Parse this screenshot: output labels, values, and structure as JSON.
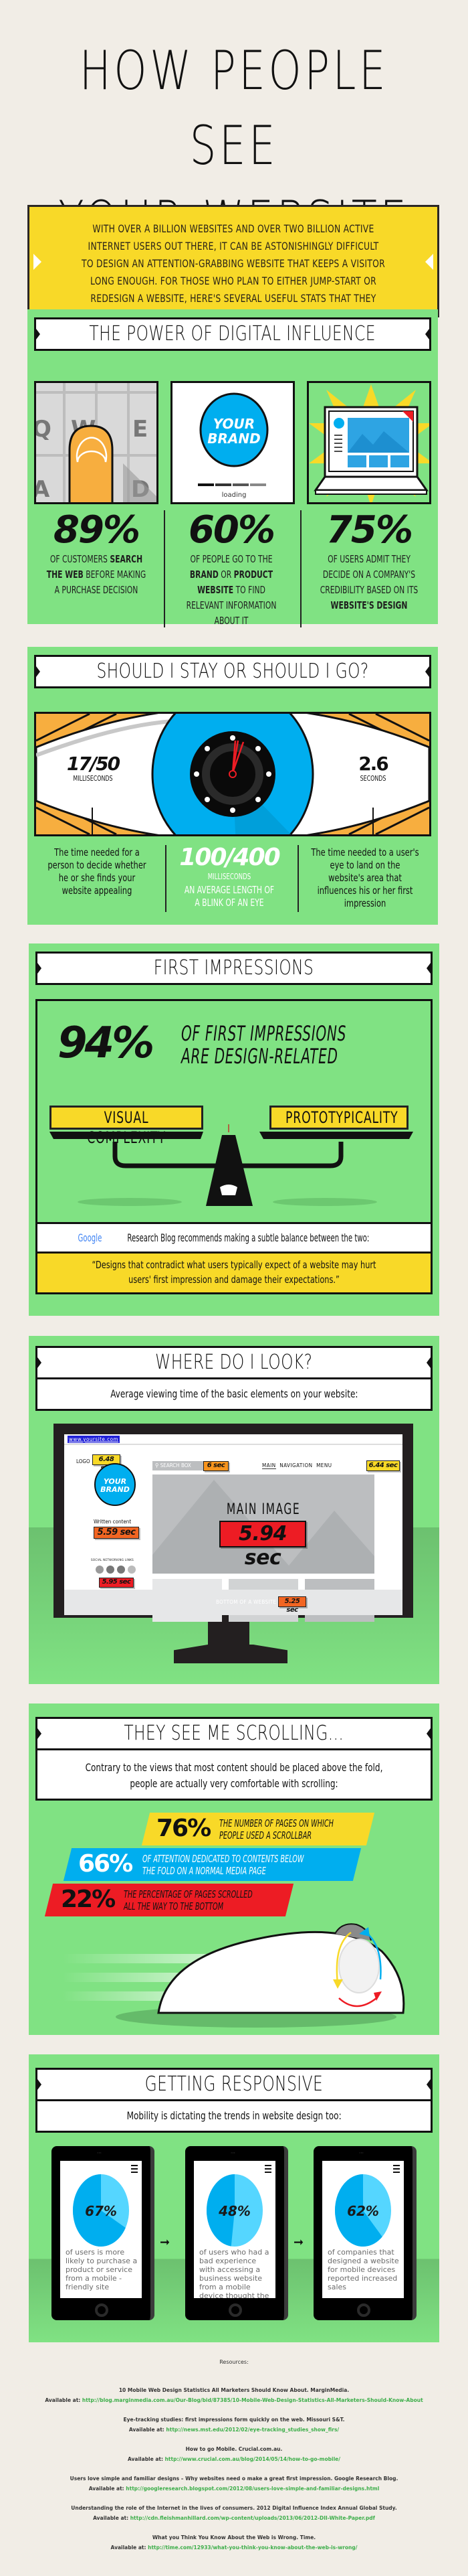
{
  "title": "HOW PEOPLE SEE YOUR WEBSITE",
  "title_lines": [
    "HOW PEOPLE SEE",
    "YOUR WEBSITE"
  ],
  "intro": "With over a billion websites and over two billion active internet users out there, it can be astonishingly difficult to design an attention-grabbing website that keeps a visitor long enough. For those who plan to either jump-start or redesign a website, here's several useful stats that they should take into consideration before starting the whole process.",
  "colors": {
    "green": "#80e283",
    "yellow": "#f8d928",
    "blue": "#00aeef",
    "orange": "#f7ae3f",
    "red": "#ed1c24",
    "background": "#f1ede6"
  },
  "s1": {
    "heading": "THE POWER OF DIGITAL INFLUENCE",
    "keys": [
      "Q",
      "W",
      "E",
      "A",
      "D"
    ],
    "brand_line1": "YOUR",
    "brand_line2": "BRAND",
    "loading": "loading",
    "stats": [
      {
        "pct": "89%",
        "pre": "of customers ",
        "bold": "search the web",
        "post": " before making a purchase decision"
      },
      {
        "pct": "60%",
        "pre": "of people go to the ",
        "bold": "brand",
        "mid": " or ",
        "bold2": "product website",
        "post": " to find relevant information about it"
      },
      {
        "pct": "75%",
        "pre": "of users admit they decide on a company's credibility based on its ",
        "bold": "website's design",
        "post": ""
      }
    ]
  },
  "s2": {
    "heading": "SHOULD I STAY OR SHOULD I GO?",
    "left_value": "17/50",
    "left_unit": "MILLISECONDS",
    "right_value": "2.6",
    "right_unit": "SECONDS",
    "left_desc": "The time needed for a person to decide whether he or she finds your website appealing",
    "center_value": "100/400",
    "center_unit": "MILLISECONDS",
    "center_desc": "AN AVERAGE LENGTH OF A BLINK OF AN EYE",
    "right_desc": "The time needed to a user's eye to land on the website's area that influences his or her first impression"
  },
  "s3": {
    "heading": "FIRST IMPRESSIONS",
    "pct": "94%",
    "line1": "OF FIRST IMPRESSIONS",
    "line2": "ARE DESIGN-RELATED",
    "left_tag": "VISUAL COMPLEXITY",
    "right_tag": "PROTOTYPICALITY",
    "google": "Google",
    "google_rest": " Research Blog recommends making a subtle balance between the two:",
    "quote": "“Designs that contradict what users typically expect of a website may hurt users' first impression and damage their expectations.”"
  },
  "s4": {
    "heading": "WHERE DO I LOOK?",
    "subtitle": "Average viewing time of the basic elements on your website:",
    "url": "www.yoursite.com",
    "logo_label": "LOGO",
    "logo_time": "6.48 sec",
    "search_label": "SEARCH BOX",
    "search_time": "6 sec",
    "nav_main": "MAIN",
    "nav_rest": "NAVIGATION  MENU",
    "nav_time": "6.44 sec",
    "main_image_label": "MAIN IMAGE",
    "main_image_time": "5.94 sec",
    "written_label": "Written content",
    "written_time": "5.59 sec",
    "social_label": "SOCIAL NETWORKING LINKS",
    "social_time": "5.95 sec",
    "bottom_label": "BOTTOM OF A WEBSITE",
    "bottom_time": "5.25 sec"
  },
  "s5": {
    "heading": "THEY SEE ME SCROLLING...",
    "subtitle": "Contrary to the views that most content should be placed above the fold, people are actually very comfortable with scrolling:",
    "stats": [
      {
        "pct": "76%",
        "l1": "THE NUMBER OF PAGES ON WHICH",
        "l2": "PEOPLE USED A SCROLLBAR"
      },
      {
        "pct": "66%",
        "l1": "OF ATTENTION DEDICATED TO CONTENTS BELOW",
        "l2": "THE FOLD ON A NORMAL MEDIA PAGE"
      },
      {
        "pct": "22%",
        "l1": "THE PERCENTAGE OF PAGES SCROLLED",
        "l2": "ALL THE WAY TO THE BOTTOM"
      }
    ]
  },
  "s6": {
    "heading": "GETTING RESPONSIVE",
    "subtitle": "Mobility is dictating the trends in website design too:",
    "phones": [
      {
        "pct": "67%",
        "value": 0.67,
        "text": "of users is more likely to purchase a product or service from a mobile - friendly site"
      },
      {
        "pct": "48%",
        "value": 0.48,
        "text": "of users who had a bad experience with accessing a business website from a mobile device thought the business didn't care"
      },
      {
        "pct": "62%",
        "value": 0.62,
        "text": "of companies that designed a website for mobile devices reported increased sales"
      }
    ]
  },
  "resources": {
    "heading": "Resources:",
    "available_label": "Available at:",
    "items": [
      {
        "title": "10 Mobile Web Design Statistics All Marketers Should Know About. MarginMedia.",
        "url": "http://blog.marginmedia.com.au/Our-Blog/bid/87385/10-Mobile-Web-Design-Statistics-All-Marketers-Should-Know-About"
      },
      {
        "title": "Eye-tracking studies: first impressions form quickly on the web. Missouri S&T.",
        "url": "http://news.mst.edu/2012/02/eye-tracking_studies_show_firs/"
      },
      {
        "title": "How to go Mobile. Crucial.com.au.",
        "url": "http://www.crucial.com.au/blog/2014/05/14/how-to-go-mobile/"
      },
      {
        "title": "Users love simple and familiar designs – Why websites need o make a great first impression. Google Research Blog.",
        "url": "http://googleresearch.blogspot.com/2012/08/users-love-simple-and-familiar-designs.html"
      },
      {
        "title": "Understanding the role of the Internet in the lives of consumers. 2012 Digital Influence Index Annual Global Study.",
        "url": "http://cdn.fleishmanhillard.com/wp-content/uploads/2013/06/2012-DII-White-Paper.pdf"
      },
      {
        "title": "What you Think You Know About the Web is Wrong. Time.",
        "url": "http://time.com/12933/what-you-think-you-know-about-the-web-is-wrong/"
      }
    ]
  }
}
